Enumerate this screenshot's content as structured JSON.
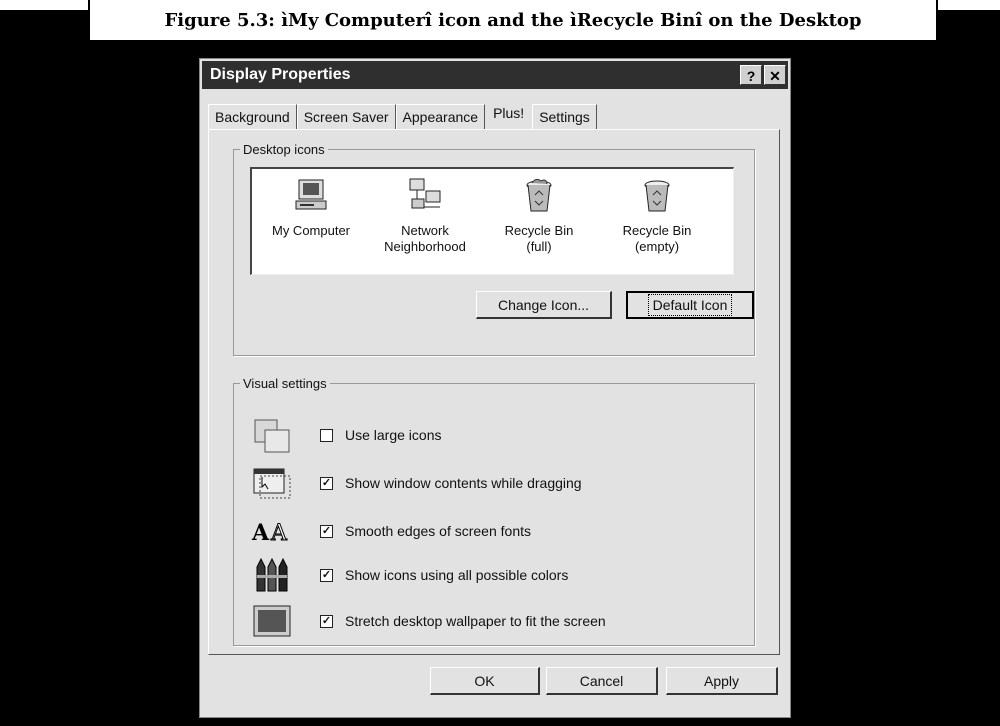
{
  "caption": "Figure 5.3: ìMy Computerî icon and the ìRecycle Binî on the Desktop",
  "dialog": {
    "title": "Display Properties",
    "help_label": "?",
    "close_label": "✕",
    "tabs": [
      "Background",
      "Screen Saver",
      "Appearance",
      "Plus!",
      "Settings"
    ],
    "active_tab": "Plus!",
    "desktop_icons": {
      "label": "Desktop icons",
      "items": [
        {
          "label_line1": "My Computer",
          "label_line2": "",
          "icon": "my-computer-icon"
        },
        {
          "label_line1": "Network",
          "label_line2": "Neighborhood",
          "icon": "network-neighborhood-icon"
        },
        {
          "label_line1": "Recycle Bin",
          "label_line2": "(full)",
          "icon": "recycle-bin-full-icon"
        },
        {
          "label_line1": "Recycle Bin",
          "label_line2": "(empty)",
          "icon": "recycle-bin-empty-icon"
        }
      ],
      "change_icon_label": "Change Icon...",
      "default_icon_label": "Default Icon"
    },
    "visual_settings": {
      "label": "Visual settings",
      "options": [
        {
          "label": "Use large icons",
          "checked": false,
          "icon": "large-icons-icon"
        },
        {
          "label": "Show window contents while dragging",
          "checked": true,
          "icon": "window-drag-icon"
        },
        {
          "label": "Smooth edges of screen fonts",
          "checked": true,
          "icon": "font-smoothing-icon"
        },
        {
          "label": "Show icons using all possible colors",
          "checked": true,
          "icon": "crayons-icon"
        },
        {
          "label": "Stretch desktop wallpaper to fit the screen",
          "checked": true,
          "icon": "wallpaper-stretch-icon"
        }
      ]
    },
    "buttons": {
      "ok": "OK",
      "cancel": "Cancel",
      "apply": "Apply"
    }
  }
}
